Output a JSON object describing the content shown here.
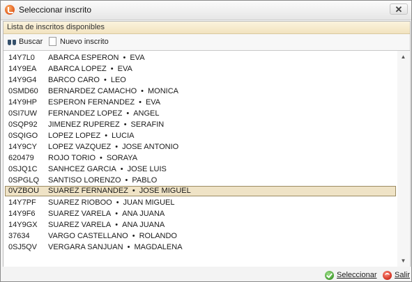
{
  "window": {
    "title": "Seleccionar inscrito",
    "close_glyph": "✕",
    "app_icon": "app-logo-icon"
  },
  "panel": {
    "header": "Lista de inscritos disponibles"
  },
  "toolbar": {
    "search_label": "Buscar",
    "search_icon": "binoculars-icon",
    "new_label": "Nuevo inscrito",
    "new_icon": "document-icon"
  },
  "list": {
    "separator": "•",
    "selected_code": "0VZBOU",
    "rows": [
      {
        "code": "14Y7L0",
        "surname": "ABARCA ESPERON",
        "first": "EVA"
      },
      {
        "code": "14Y9EA",
        "surname": "ABARCA LOPEZ",
        "first": "EVA"
      },
      {
        "code": "14Y9G4",
        "surname": "BARCO CARO",
        "first": "LEO"
      },
      {
        "code": "0SMD60",
        "surname": "BERNARDEZ CAMACHO",
        "first": "MONICA"
      },
      {
        "code": "14Y9HP",
        "surname": "ESPERON FERNANDEZ",
        "first": "EVA"
      },
      {
        "code": "0SI7UW",
        "surname": "FERNANDEZ LOPEZ",
        "first": "ANGEL"
      },
      {
        "code": "0SQP92",
        "surname": "JIMENEZ RUPEREZ",
        "first": "SERAFIN"
      },
      {
        "code": "0SQIGO",
        "surname": "LOPEZ LOPEZ",
        "first": "LUCIA"
      },
      {
        "code": "14Y9CY",
        "surname": "LOPEZ VAZQUEZ",
        "first": "JOSE ANTONIO"
      },
      {
        "code": "620479",
        "surname": "ROJO TORIO",
        "first": "SORAYA"
      },
      {
        "code": "0SJQ1C",
        "surname": "SANHCEZ GARCIA",
        "first": "JOSE LUIS"
      },
      {
        "code": "0SPGLQ",
        "surname": "SANTISO LORENZO",
        "first": "PABLO"
      },
      {
        "code": "0VZBOU",
        "surname": "SUAREZ FERNANDEZ",
        "first": "JOSE MIGUEL"
      },
      {
        "code": "14Y7PF",
        "surname": "SUAREZ RIOBOO",
        "first": "JUAN MIGUEL"
      },
      {
        "code": "14Y9F6",
        "surname": "SUAREZ VARELA",
        "first": "ANA JUANA"
      },
      {
        "code": "14Y9GX",
        "surname": "SUAREZ VARELA",
        "first": "ANA JUANA"
      },
      {
        "code": "37634",
        "surname": "VARGO CASTELLANO",
        "first": "ROLANDO"
      },
      {
        "code": "0SJ5QV",
        "surname": "VERGARA SANJUAN",
        "first": "MAGDALENA"
      }
    ]
  },
  "scrollbar": {
    "up_glyph": "▲",
    "down_glyph": "▼"
  },
  "footer": {
    "select_label": "Seleccionar",
    "select_icon": "check-icon",
    "exit_label": "Salir",
    "exit_icon": "power-icon"
  },
  "colors": {
    "selection_bg": "#efe3c6",
    "header_bg": "#f2e3bf"
  }
}
